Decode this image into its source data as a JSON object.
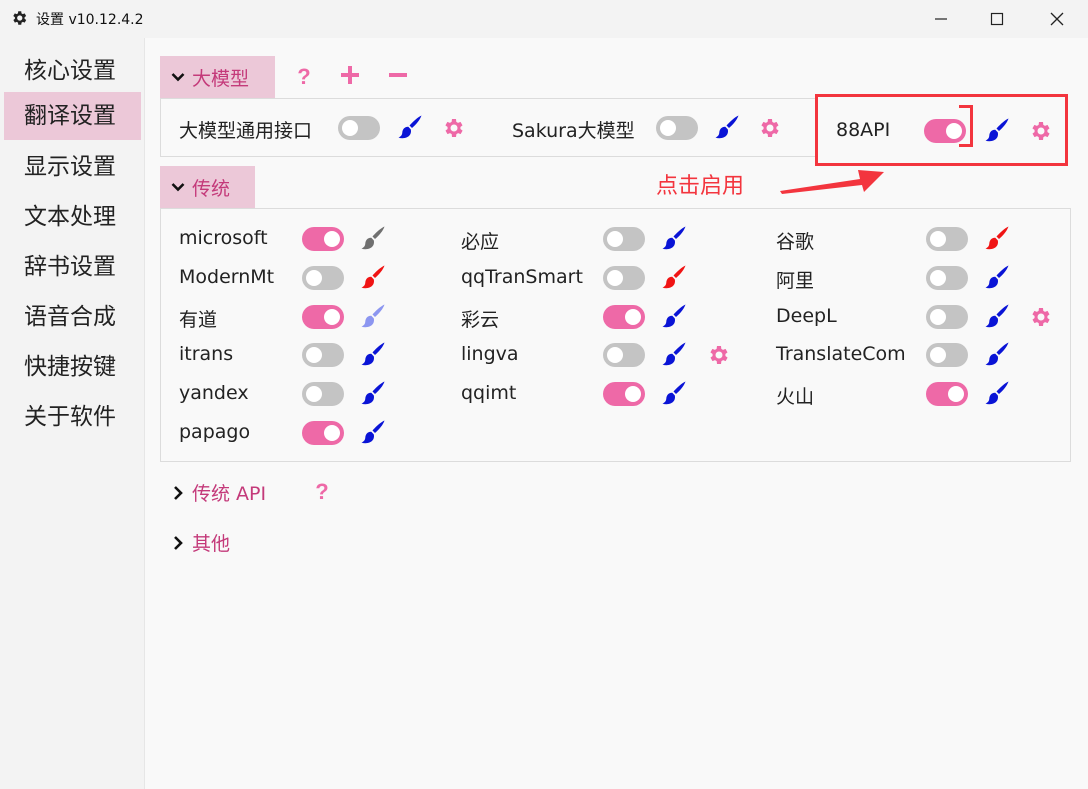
{
  "window": {
    "title": "设置 v10.12.4.2",
    "icon": "gear-icon",
    "controls": [
      "minimize",
      "maximize",
      "close"
    ]
  },
  "sidebar": {
    "items": [
      {
        "label": "核心设置",
        "active": false
      },
      {
        "label": "翻译设置",
        "active": true
      },
      {
        "label": "显示设置",
        "active": false
      },
      {
        "label": "文本处理",
        "active": false
      },
      {
        "label": "辞书设置",
        "active": false
      },
      {
        "label": "语音合成",
        "active": false
      },
      {
        "label": "快捷按键",
        "active": false
      },
      {
        "label": "关于软件",
        "active": false
      }
    ]
  },
  "llm_section": {
    "title": "大模型",
    "expanded": true,
    "buttons": [
      "help-icon",
      "plus-icon",
      "minus-icon"
    ],
    "items": [
      {
        "label": "大模型通用接口",
        "enabled": false,
        "brush_color": "#0a14d6",
        "settings": true
      },
      {
        "label": "Sakura大模型",
        "enabled": false,
        "brush_color": "#0a14d6",
        "settings": true
      },
      {
        "label": "88API",
        "enabled": true,
        "brush_color": "#0a14d6",
        "settings": true
      }
    ]
  },
  "annotation": {
    "text": "点击启用",
    "color": "#f3353e"
  },
  "traditional_section": {
    "title": "传统",
    "expanded": true,
    "items": [
      {
        "label": "microsoft",
        "enabled": true,
        "brush_color": "#707070",
        "settings": false
      },
      {
        "label": "必应",
        "enabled": false,
        "brush_color": "#0a14d6",
        "settings": false
      },
      {
        "label": "谷歌",
        "enabled": false,
        "brush_color": "#f01414",
        "settings": false
      },
      {
        "label": "ModernMt",
        "enabled": false,
        "brush_color": "#f01414",
        "settings": false
      },
      {
        "label": "qqTranSmart",
        "enabled": false,
        "brush_color": "#f01414",
        "settings": false
      },
      {
        "label": "阿里",
        "enabled": false,
        "brush_color": "#0a14d6",
        "settings": false
      },
      {
        "label": "有道",
        "enabled": true,
        "brush_color": "#8c96f0",
        "settings": false
      },
      {
        "label": "彩云",
        "enabled": true,
        "brush_color": "#0a14d6",
        "settings": false
      },
      {
        "label": "DeepL",
        "enabled": false,
        "brush_color": "#0a14d6",
        "settings": true
      },
      {
        "label": "itrans",
        "enabled": false,
        "brush_color": "#0a14d6",
        "settings": false
      },
      {
        "label": "lingva",
        "enabled": false,
        "brush_color": "#0a14d6",
        "settings": true
      },
      {
        "label": "TranslateCom",
        "enabled": false,
        "brush_color": "#0a14d6",
        "settings": false
      },
      {
        "label": "yandex",
        "enabled": false,
        "brush_color": "#0a14d6",
        "settings": false
      },
      {
        "label": "qqimt",
        "enabled": true,
        "brush_color": "#0a14d6",
        "settings": false
      },
      {
        "label": "火山",
        "enabled": true,
        "brush_color": "#0a14d6",
        "settings": false
      },
      {
        "label": "papago",
        "enabled": true,
        "brush_color": "#0a14d6",
        "settings": false
      }
    ]
  },
  "collapsed_sections": [
    {
      "title": "传统 API",
      "has_help": true
    },
    {
      "title": "其他",
      "has_help": false
    }
  ],
  "colors": {
    "accent": "#ee69a7",
    "accent_text": "#c43a7a",
    "section_bg": "#ecc8d8",
    "toggle_off": "#c4c4c4",
    "settings_gear": "#ee69a7"
  }
}
